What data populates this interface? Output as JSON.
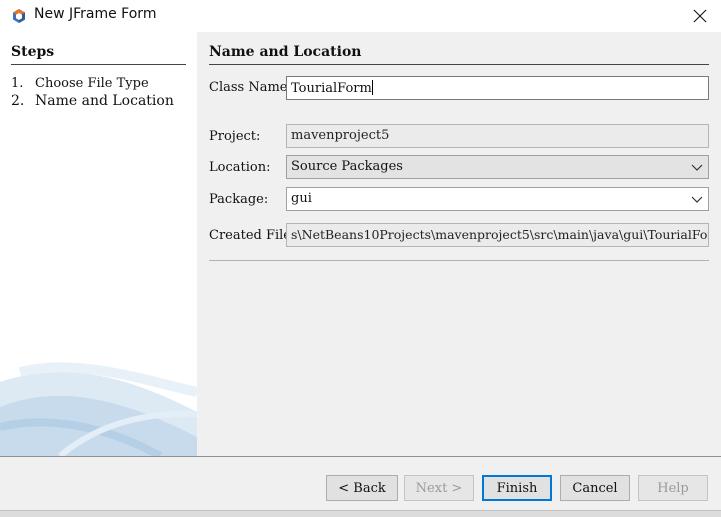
{
  "window": {
    "title": "New JFrame Form",
    "icon": "netbeans-cube-icon"
  },
  "steps": {
    "title": "Steps",
    "items": [
      {
        "number": "1.",
        "label": "Choose File Type"
      },
      {
        "number": "2.",
        "label": "Name and Location"
      }
    ]
  },
  "panel": {
    "title": "Name and Location",
    "class_name": {
      "label": "Class Name:",
      "value": "TourialForm"
    },
    "project": {
      "label": "Project:",
      "value": "mavenproject5"
    },
    "location": {
      "label": "Location:",
      "value": "Source Packages"
    },
    "package": {
      "label": "Package:",
      "value": "gui"
    },
    "created_file": {
      "label": "Created File:",
      "value": "s\\NetBeans10Projects\\mavenproject5\\src\\main\\java\\gui\\TourialForm.java"
    }
  },
  "buttons": {
    "back": "< Back",
    "next": "Next >",
    "finish": "Finish",
    "cancel": "Cancel",
    "help": "Help"
  },
  "colors": {
    "accent": "#0078d7",
    "panel_bg": "#f0f0f0",
    "icon_orange": "#e3762b",
    "icon_blue": "#3a73b8"
  }
}
